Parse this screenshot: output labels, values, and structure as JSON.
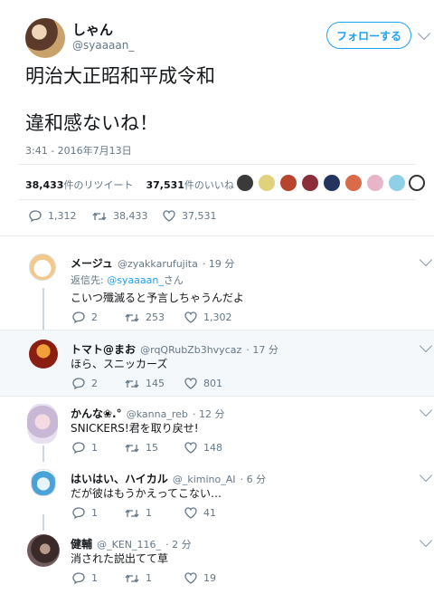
{
  "header": {
    "display_name": "しゃん",
    "handle": "@syaaaan_",
    "follow_label": "フォローする"
  },
  "tweet": {
    "line1": "明治大正昭和平成令和",
    "line2": "違和感ないね！",
    "timestamp": "3:41 - 2016年7月13日",
    "retweet_count": "38,433",
    "retweet_label": "件のリツイート",
    "like_count": "37,531",
    "like_label": "件のいいね",
    "actions": {
      "replies": "1,312",
      "retweets": "38,433",
      "likes": "37,531"
    }
  },
  "replies": [
    {
      "name": "メージュ",
      "handle": "@zyakkarufujita",
      "time": "· 19 分",
      "reply_to_label": "返信先: ",
      "reply_to_handle": "@syaaaan_",
      "reply_to_suffix": "さん",
      "text": "こいつ殲滅ると予言しちゃうんだよ",
      "replies": "2",
      "retweets": "253",
      "likes": "1,302"
    },
    {
      "name": "トマト@まお",
      "handle": "@rqQRubZb3hvycaz",
      "time": "· 17 分",
      "text": "ほら、スニッカーズ",
      "replies": "2",
      "retweets": "145",
      "likes": "801"
    },
    {
      "name": "かんな❀.°",
      "handle": "@kanna_reb",
      "time": "· 12 分",
      "text": "SNICKERS!君を取り戻せ!",
      "replies": "1",
      "retweets": "15",
      "likes": "148"
    },
    {
      "name": "はいはい、ハイカル",
      "handle": "@_kimino_AI",
      "time": "· 6 分",
      "text": "だが彼はもうかえってこない…",
      "replies": "1",
      "retweets": "1",
      "likes": "41"
    },
    {
      "name": "健輔",
      "handle": "@_KEN_116_",
      "time": "· 2 分",
      "text": "消された説出てて草",
      "replies": "1",
      "retweets": "1",
      "likes": "19"
    }
  ],
  "colors": {
    "accent": "#1da1f2",
    "muted": "#657786",
    "highlight_bg": "#f5f8fa"
  }
}
